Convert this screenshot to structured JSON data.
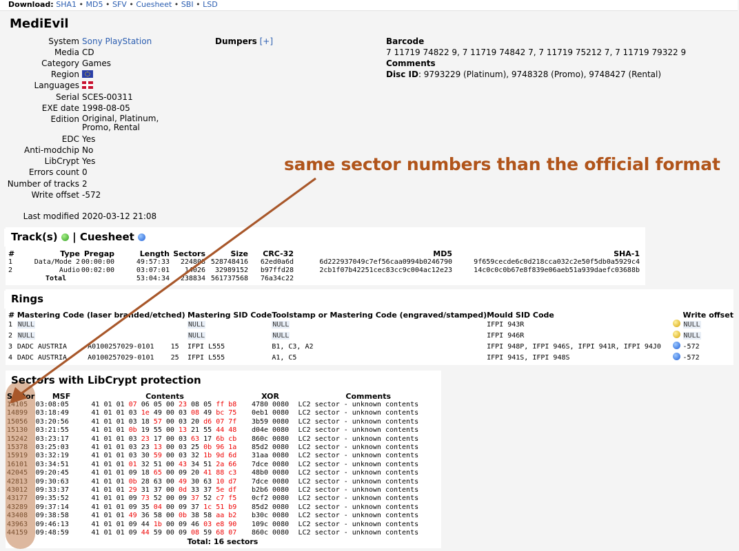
{
  "topbar": {
    "download_label": "Download:",
    "links": [
      "SHA1",
      "MD5",
      "SFV",
      "Cuesheet",
      "SBI",
      "LSD"
    ]
  },
  "title": "MediEvil",
  "info": {
    "system_label": "System",
    "system_val": "Sony PlayStation",
    "media_label": "Media",
    "media_val": "CD",
    "category_label": "Category",
    "category_val": "Games",
    "region_label": "Region",
    "languages_label": "Languages",
    "serial_label": "Serial",
    "serial_val": "SCES-00311",
    "exe_label": "EXE date",
    "exe_val": "1998-08-05",
    "edition_label": "Edition",
    "edition_val1": "Original, Platinum,",
    "edition_val2": "Promo, Rental",
    "edc_label": "EDC",
    "edc_val": "Yes",
    "antimod_label": "Anti-modchip",
    "antimod_val": "No",
    "libcrypt_label": "LibCrypt",
    "libcrypt_val": "Yes",
    "errors_label": "Errors count",
    "errors_val": "0",
    "tracks_label": "Number of tracks",
    "tracks_val": "2",
    "offset_label": "Write offset",
    "offset_val": "-572",
    "modified_label": "Last modified",
    "modified_val": "2020-03-12 21:08"
  },
  "dumpers": {
    "label": "Dumpers",
    "toggle": "[+]"
  },
  "barcode": {
    "label": "Barcode",
    "value": "7 11719 74822 9, 7 11719 74842 7, 7 11719 75212 7, 7 11719 79322 9",
    "comments_label": "Comments",
    "discid_label": "Disc ID",
    "discid_value": ": 9793229 (Platinum), 9748328 (Promo), 9748427 (Rental)"
  },
  "annotation": "same sector numbers than the official format",
  "tracks": {
    "heading": "Track(s)",
    "cuesheet": "Cuesheet",
    "sep": "|",
    "columns": [
      "#",
      "Type",
      "Pregap",
      "Length",
      "Sectors",
      "Size",
      "CRC-32",
      "MD5",
      "SHA-1"
    ],
    "rows": [
      [
        "1",
        "Data/Mode 2",
        "00:00:00",
        "49:57:33",
        "224808",
        "528748416",
        "62ed0a6d",
        "6d222937049c7ef56caa0994b0246790",
        "9f659cecde6c0d218cca032c2e50f5db0a5929c4"
      ],
      [
        "2",
        "Audio",
        "00:02:00",
        "03:07:01",
        "14026",
        "32989152",
        "b97ffd28",
        "2cb1f07b42251cec83cc9c004ac12e23",
        "14c0c0c0b67e8f839e06aeb51a939daefc03688b"
      ]
    ],
    "total": {
      "label": "Total",
      "length": "53:04:34",
      "sectors": "238834",
      "size": "561737568",
      "crc": "76a34c22"
    }
  },
  "rings": {
    "heading": "Rings",
    "columns": [
      "#",
      "Mastering Code (laser branded/etched)",
      "Mastering SID Code",
      "Toolstamp or Mastering Code (engraved/stamped)",
      "Mould SID Code",
      "Write offset"
    ],
    "rows": [
      {
        "n": "1",
        "master": "NULL",
        "sid": "NULL",
        "tool": "NULL",
        "mould": "IFPI 943R",
        "dot": "yellow",
        "offset": "NULL"
      },
      {
        "n": "2",
        "master": "NULL",
        "sid": "NULL",
        "tool": "NULL",
        "mould": "IFPI 946R",
        "dot": "yellow",
        "offset": "NULL"
      },
      {
        "n": "3",
        "master": "DADC AUSTRIA     A0100257029-0101    15",
        "sid": "IFPI L555",
        "tool": "B1, C3, A2",
        "mould": "IFPI 948P, IFPI 946S, IFPI 941R, IFPI 94J0",
        "dot": "blue",
        "offset": "-572"
      },
      {
        "n": "4",
        "master": "DADC AUSTRIA     A0100257029-0101    25",
        "sid": "IFPI L555",
        "tool": "A1, C5",
        "mould": "IFPI 941S, IFPI 948S",
        "dot": "blue",
        "offset": "-572"
      }
    ]
  },
  "libcrypt": {
    "heading": "Sectors with LibCrypt protection",
    "columns": [
      "Sector",
      "MSF",
      "Contents",
      "XOR",
      "Comments"
    ],
    "rows": [
      {
        "sector": "14105",
        "msf": "03:08:05",
        "bytes": [
          "41",
          "01",
          "01",
          "07",
          "06",
          "05",
          "00",
          "23",
          "08",
          "05",
          "ff",
          "b8"
        ],
        "red": [
          3,
          7,
          10,
          11
        ],
        "xor": "4780 0080",
        "comment": "LC2 sector - unknown contents"
      },
      {
        "sector": "14899",
        "msf": "03:18:49",
        "bytes": [
          "41",
          "01",
          "01",
          "03",
          "1e",
          "49",
          "00",
          "03",
          "08",
          "49",
          "bc",
          "75"
        ],
        "red": [
          4,
          8,
          10,
          11
        ],
        "xor": "0eb1 0080",
        "comment": "LC2 sector - unknown contents"
      },
      {
        "sector": "15056",
        "msf": "03:20:56",
        "bytes": [
          "41",
          "01",
          "01",
          "03",
          "18",
          "57",
          "00",
          "03",
          "20",
          "d6",
          "07",
          "7f"
        ],
        "red": [
          5,
          9,
          10,
          11
        ],
        "xor": "3b59 0080",
        "comment": "LC2 sector - unknown contents"
      },
      {
        "sector": "15130",
        "msf": "03:21:55",
        "bytes": [
          "41",
          "01",
          "01",
          "0b",
          "19",
          "55",
          "00",
          "13",
          "21",
          "55",
          "44",
          "48"
        ],
        "red": [
          3,
          7,
          10,
          11
        ],
        "xor": "d04e 0080",
        "comment": "LC2 sector - unknown contents"
      },
      {
        "sector": "15242",
        "msf": "03:23:17",
        "bytes": [
          "41",
          "01",
          "01",
          "03",
          "23",
          "17",
          "00",
          "03",
          "63",
          "17",
          "6b",
          "cb"
        ],
        "red": [
          4,
          8,
          10,
          11
        ],
        "xor": "860c 0080",
        "comment": "LC2 sector - unknown contents"
      },
      {
        "sector": "15378",
        "msf": "03:25:03",
        "bytes": [
          "41",
          "01",
          "01",
          "03",
          "23",
          "13",
          "00",
          "03",
          "25",
          "0b",
          "96",
          "1a"
        ],
        "red": [
          5,
          9,
          10,
          11
        ],
        "xor": "85d2 0080",
        "comment": "LC2 sector - unknown contents"
      },
      {
        "sector": "15919",
        "msf": "03:32:19",
        "bytes": [
          "41",
          "01",
          "01",
          "03",
          "30",
          "59",
          "00",
          "03",
          "32",
          "1b",
          "9d",
          "6d"
        ],
        "red": [
          5,
          9,
          10,
          11
        ],
        "xor": "31aa 0080",
        "comment": "LC2 sector - unknown contents"
      },
      {
        "sector": "16101",
        "msf": "03:34:51",
        "bytes": [
          "41",
          "01",
          "01",
          "01",
          "32",
          "51",
          "00",
          "43",
          "34",
          "51",
          "2a",
          "66"
        ],
        "red": [
          3,
          7,
          10,
          11
        ],
        "xor": "7dce 0080",
        "comment": "LC2 sector - unknown contents"
      },
      {
        "sector": "42045",
        "msf": "09:20:45",
        "bytes": [
          "41",
          "01",
          "01",
          "09",
          "18",
          "65",
          "00",
          "09",
          "20",
          "41",
          "88",
          "c3"
        ],
        "red": [
          5,
          9,
          10,
          11
        ],
        "xor": "48b0 0080",
        "comment": "LC2 sector - unknown contents"
      },
      {
        "sector": "42813",
        "msf": "09:30:63",
        "bytes": [
          "41",
          "01",
          "01",
          "0b",
          "28",
          "63",
          "00",
          "49",
          "30",
          "63",
          "10",
          "d7"
        ],
        "red": [
          3,
          7,
          10,
          11
        ],
        "xor": "7dce 0080",
        "comment": "LC2 sector - unknown contents"
      },
      {
        "sector": "43012",
        "msf": "09:33:37",
        "bytes": [
          "41",
          "01",
          "01",
          "29",
          "31",
          "37",
          "00",
          "0d",
          "33",
          "37",
          "5e",
          "df"
        ],
        "red": [
          3,
          7,
          10,
          11
        ],
        "xor": "b2b6 0080",
        "comment": "LC2 sector - unknown contents"
      },
      {
        "sector": "43177",
        "msf": "09:35:52",
        "bytes": [
          "41",
          "01",
          "01",
          "09",
          "73",
          "52",
          "00",
          "09",
          "37",
          "52",
          "c7",
          "f5"
        ],
        "red": [
          4,
          8,
          10,
          11
        ],
        "xor": "0cf2 0080",
        "comment": "LC2 sector - unknown contents"
      },
      {
        "sector": "43289",
        "msf": "09:37:14",
        "bytes": [
          "41",
          "01",
          "01",
          "09",
          "35",
          "04",
          "00",
          "09",
          "37",
          "1c",
          "51",
          "b9"
        ],
        "red": [
          5,
          9,
          10,
          11
        ],
        "xor": "85d2 0080",
        "comment": "LC2 sector - unknown contents"
      },
      {
        "sector": "43408",
        "msf": "09:38:58",
        "bytes": [
          "41",
          "01",
          "01",
          "49",
          "36",
          "58",
          "00",
          "0b",
          "38",
          "58",
          "aa",
          "b2"
        ],
        "red": [
          3,
          7,
          10,
          11
        ],
        "xor": "b30c 0080",
        "comment": "LC2 sector - unknown contents"
      },
      {
        "sector": "43963",
        "msf": "09:46:13",
        "bytes": [
          "41",
          "01",
          "01",
          "09",
          "44",
          "1b",
          "00",
          "09",
          "46",
          "03",
          "e8",
          "90"
        ],
        "red": [
          5,
          9,
          10,
          11
        ],
        "xor": "109c 0080",
        "comment": "LC2 sector - unknown contents"
      },
      {
        "sector": "44159",
        "msf": "09:48:59",
        "bytes": [
          "41",
          "01",
          "01",
          "09",
          "44",
          "59",
          "00",
          "09",
          "08",
          "59",
          "68",
          "07"
        ],
        "red": [
          4,
          8,
          10,
          11
        ],
        "xor": "860c 0080",
        "comment": "LC2 sector - unknown contents"
      }
    ],
    "total": "Total: 16 sectors"
  }
}
